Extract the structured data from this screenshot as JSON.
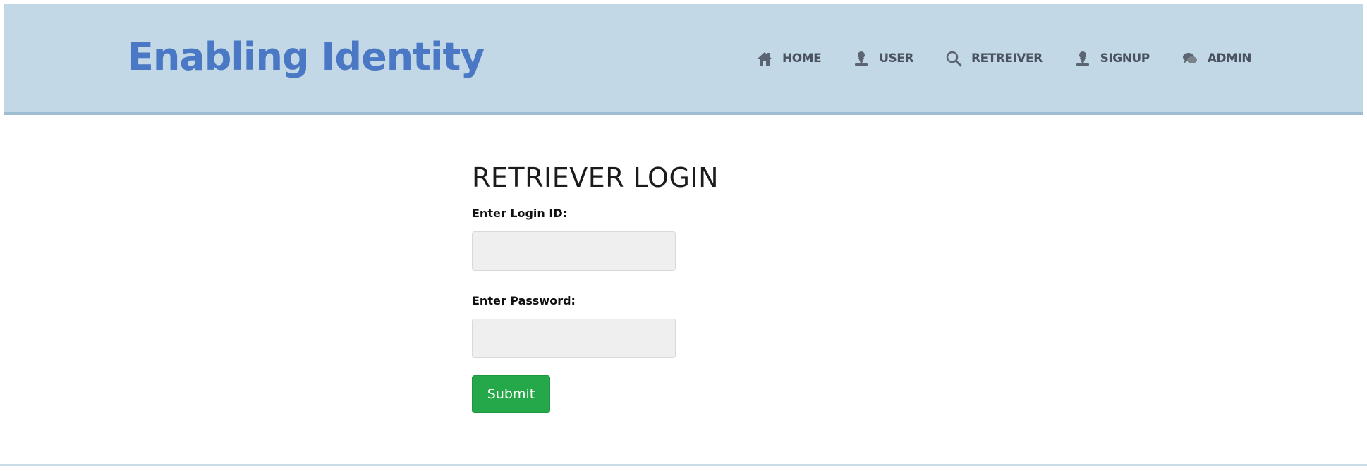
{
  "header": {
    "brand": "Enabling Identity",
    "nav": [
      {
        "label": "HOME",
        "icon": "home-icon"
      },
      {
        "label": "USER",
        "icon": "user-icon"
      },
      {
        "label": "RETREIVER",
        "icon": "search-icon"
      },
      {
        "label": "SIGNUP",
        "icon": "user-icon"
      },
      {
        "label": "ADMIN",
        "icon": "chat-icon"
      }
    ]
  },
  "form": {
    "title": "RETRIEVER LOGIN",
    "login_label": "Enter Login ID:",
    "login_value": "",
    "password_label": "Enter Password:",
    "password_value": "",
    "submit_label": "Submit"
  },
  "colors": {
    "header_bg": "#c2d8e6",
    "brand": "#4a78c4",
    "submit": "#25a84a"
  }
}
